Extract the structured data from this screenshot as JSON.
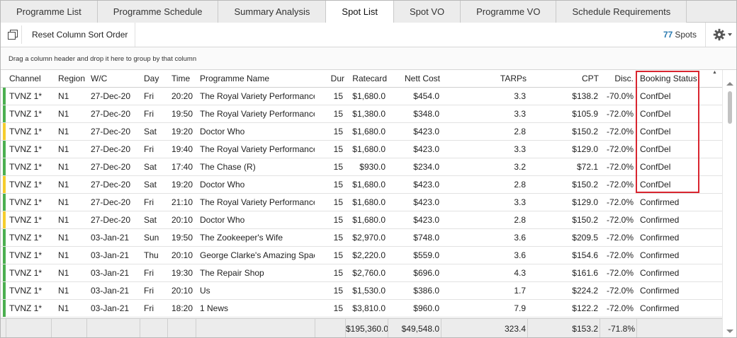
{
  "tabs": [
    {
      "label": "Programme List",
      "active": false
    },
    {
      "label": "Programme Schedule",
      "active": false
    },
    {
      "label": "Summary Analysis",
      "active": false
    },
    {
      "label": "Spot List",
      "active": true
    },
    {
      "label": "Spot VO",
      "active": false
    },
    {
      "label": "Programme VO",
      "active": false
    },
    {
      "label": "Schedule Requirements",
      "active": false
    }
  ],
  "toolbar": {
    "copy_icon": "copy-icon",
    "reset_label": "Reset Column Sort Order",
    "spot_count": "77",
    "spot_label": "Spots",
    "gear_icon": "gear-icon"
  },
  "group_panel": {
    "hint": "Drag a column header and drop it here to group by that column"
  },
  "columns": {
    "channel": "Channel",
    "region": "Region",
    "wc": "W/C",
    "day": "Day",
    "time": "Time",
    "programme": "Programme Name",
    "dur": "Dur",
    "ratecard": "Ratecard",
    "nett": "Nett Cost",
    "tarps": "TARPs",
    "cpt": "CPT",
    "disc": "Disc.",
    "status": "Booking Status"
  },
  "status_colors": {
    "green": "#4caf50",
    "yellow": "#f5cd2e"
  },
  "rows": [
    {
      "bar": "green",
      "channel": "TVNZ 1*",
      "region": "N1",
      "wc": "27-Dec-20",
      "day": "Fri",
      "time": "20:20",
      "programme": "The Royal Variety Performance",
      "dur": "15",
      "ratecard": "$1,680.0",
      "nett": "$454.0",
      "tarps": "3.3",
      "cpt": "$138.2",
      "disc": "-70.0%",
      "status": "ConfDel"
    },
    {
      "bar": "green",
      "channel": "TVNZ 1*",
      "region": "N1",
      "wc": "27-Dec-20",
      "day": "Fri",
      "time": "19:50",
      "programme": "The Royal Variety Performance",
      "dur": "15",
      "ratecard": "$1,380.0",
      "nett": "$348.0",
      "tarps": "3.3",
      "cpt": "$105.9",
      "disc": "-72.0%",
      "status": "ConfDel"
    },
    {
      "bar": "yellow",
      "channel": "TVNZ 1*",
      "region": "N1",
      "wc": "27-Dec-20",
      "day": "Sat",
      "time": "19:20",
      "programme": "Doctor Who",
      "dur": "15",
      "ratecard": "$1,680.0",
      "nett": "$423.0",
      "tarps": "2.8",
      "cpt": "$150.2",
      "disc": "-72.0%",
      "status": "ConfDel"
    },
    {
      "bar": "green",
      "channel": "TVNZ 1*",
      "region": "N1",
      "wc": "27-Dec-20",
      "day": "Fri",
      "time": "19:40",
      "programme": "The Royal Variety Performance",
      "dur": "15",
      "ratecard": "$1,680.0",
      "nett": "$423.0",
      "tarps": "3.3",
      "cpt": "$129.0",
      "disc": "-72.0%",
      "status": "ConfDel"
    },
    {
      "bar": "green",
      "channel": "TVNZ 1*",
      "region": "N1",
      "wc": "27-Dec-20",
      "day": "Sat",
      "time": "17:40",
      "programme": "The Chase (R)",
      "dur": "15",
      "ratecard": "$930.0",
      "nett": "$234.0",
      "tarps": "3.2",
      "cpt": "$72.1",
      "disc": "-72.0%",
      "status": "ConfDel"
    },
    {
      "bar": "yellow",
      "channel": "TVNZ 1*",
      "region": "N1",
      "wc": "27-Dec-20",
      "day": "Sat",
      "time": "19:20",
      "programme": "Doctor Who",
      "dur": "15",
      "ratecard": "$1,680.0",
      "nett": "$423.0",
      "tarps": "2.8",
      "cpt": "$150.2",
      "disc": "-72.0%",
      "status": "ConfDel"
    },
    {
      "bar": "green",
      "channel": "TVNZ 1*",
      "region": "N1",
      "wc": "27-Dec-20",
      "day": "Fri",
      "time": "21:10",
      "programme": "The Royal Variety Performance",
      "dur": "15",
      "ratecard": "$1,680.0",
      "nett": "$423.0",
      "tarps": "3.3",
      "cpt": "$129.0",
      "disc": "-72.0%",
      "status": "Confirmed"
    },
    {
      "bar": "yellow",
      "channel": "TVNZ 1*",
      "region": "N1",
      "wc": "27-Dec-20",
      "day": "Sat",
      "time": "20:10",
      "programme": "Doctor Who",
      "dur": "15",
      "ratecard": "$1,680.0",
      "nett": "$423.0",
      "tarps": "2.8",
      "cpt": "$150.2",
      "disc": "-72.0%",
      "status": "Confirmed"
    },
    {
      "bar": "green",
      "channel": "TVNZ 1*",
      "region": "N1",
      "wc": "03-Jan-21",
      "day": "Sun",
      "time": "19:50",
      "programme": "The Zookeeper's Wife",
      "dur": "15",
      "ratecard": "$2,970.0",
      "nett": "$748.0",
      "tarps": "3.6",
      "cpt": "$209.5",
      "disc": "-72.0%",
      "status": "Confirmed"
    },
    {
      "bar": "green",
      "channel": "TVNZ 1*",
      "region": "N1",
      "wc": "03-Jan-21",
      "day": "Thu",
      "time": "20:10",
      "programme": "George Clarke's Amazing Spac",
      "dur": "15",
      "ratecard": "$2,220.0",
      "nett": "$559.0",
      "tarps": "3.6",
      "cpt": "$154.6",
      "disc": "-72.0%",
      "status": "Confirmed"
    },
    {
      "bar": "green",
      "channel": "TVNZ 1*",
      "region": "N1",
      "wc": "03-Jan-21",
      "day": "Fri",
      "time": "19:30",
      "programme": "The Repair Shop",
      "dur": "15",
      "ratecard": "$2,760.0",
      "nett": "$696.0",
      "tarps": "4.3",
      "cpt": "$161.6",
      "disc": "-72.0%",
      "status": "Confirmed"
    },
    {
      "bar": "green",
      "channel": "TVNZ 1*",
      "region": "N1",
      "wc": "03-Jan-21",
      "day": "Fri",
      "time": "20:10",
      "programme": "Us",
      "dur": "15",
      "ratecard": "$1,530.0",
      "nett": "$386.0",
      "tarps": "1.7",
      "cpt": "$224.2",
      "disc": "-72.0%",
      "status": "Confirmed"
    },
    {
      "bar": "green",
      "channel": "TVNZ 1*",
      "region": "N1",
      "wc": "03-Jan-21",
      "day": "Fri",
      "time": "18:20",
      "programme": "1 News",
      "dur": "15",
      "ratecard": "$3,810.0",
      "nett": "$960.0",
      "tarps": "7.9",
      "cpt": "$122.2",
      "disc": "-72.0%",
      "status": "Confirmed"
    }
  ],
  "totals": {
    "ratecard": "$195,360.0",
    "nett": "$49,548.0",
    "tarps": "323.4",
    "cpt": "$153.2",
    "disc": "-71.8%"
  }
}
